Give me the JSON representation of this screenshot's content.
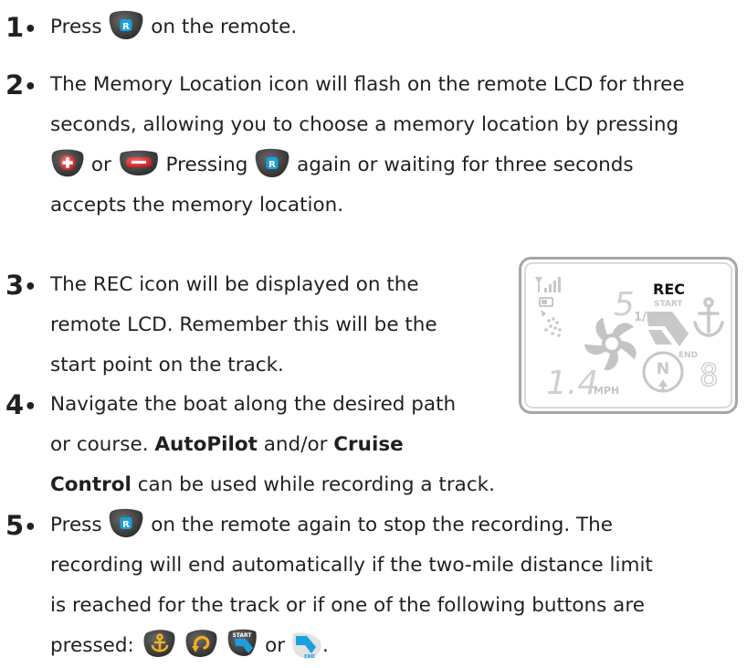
{
  "steps": [
    {
      "number": "1",
      "lines": [
        {
          "a": "Press",
          "b": "on the remote."
        }
      ]
    },
    {
      "number": "2",
      "lines": [
        {
          "a": "The Memory Location icon will flash on the remote LCD for three"
        },
        {
          "a": "seconds, allowing you to choose a memory location by pressing"
        },
        {
          "a": "or",
          "b": "Pressing",
          "c": "again or waiting for three seconds"
        },
        {
          "a": "accepts the memory location."
        }
      ]
    },
    {
      "number": "3",
      "lines": [
        {
          "a": "The REC icon will be displayed on the"
        },
        {
          "a": "remote LCD.  Remember this will be the"
        },
        {
          "a": "start point on the track."
        }
      ]
    },
    {
      "number": "4",
      "lines": [
        {
          "a": "Navigate the boat along the desired path"
        },
        {
          "a": "or course. ",
          "b": "AutoPilot",
          "c": " and/or ",
          "d": "Cruise"
        },
        {
          "a": "Control",
          "b": " can be used while recording a track."
        }
      ]
    },
    {
      "number": "5",
      "lines": [
        {
          "a": "Press",
          "b": "on the remote again to stop the recording.  The"
        },
        {
          "a": "recording will end automatically if the two-mile distance limit"
        },
        {
          "a": "is reached for the track or if one of the following buttons are"
        },
        {
          "a": "pressed:",
          "b": "or",
          "c": "."
        }
      ]
    }
  ],
  "lcd": {
    "rec": "REC",
    "start": "START",
    "end": "END",
    "speed_digit": "5",
    "speed_fraction": "1/2",
    "value": "1.4",
    "unit": "MPH",
    "compass": "N",
    "memory_digit": "8"
  },
  "colors": {
    "button_dark": "#3a3a3a",
    "r_blue": "#1aa0e0",
    "plus_red": "#e02a2a",
    "minus_red": "#e03030",
    "anchor_gold": "#e6a21a",
    "lcd_border": "#9a9a9a",
    "lcd_faint": "#c8c8c8"
  }
}
